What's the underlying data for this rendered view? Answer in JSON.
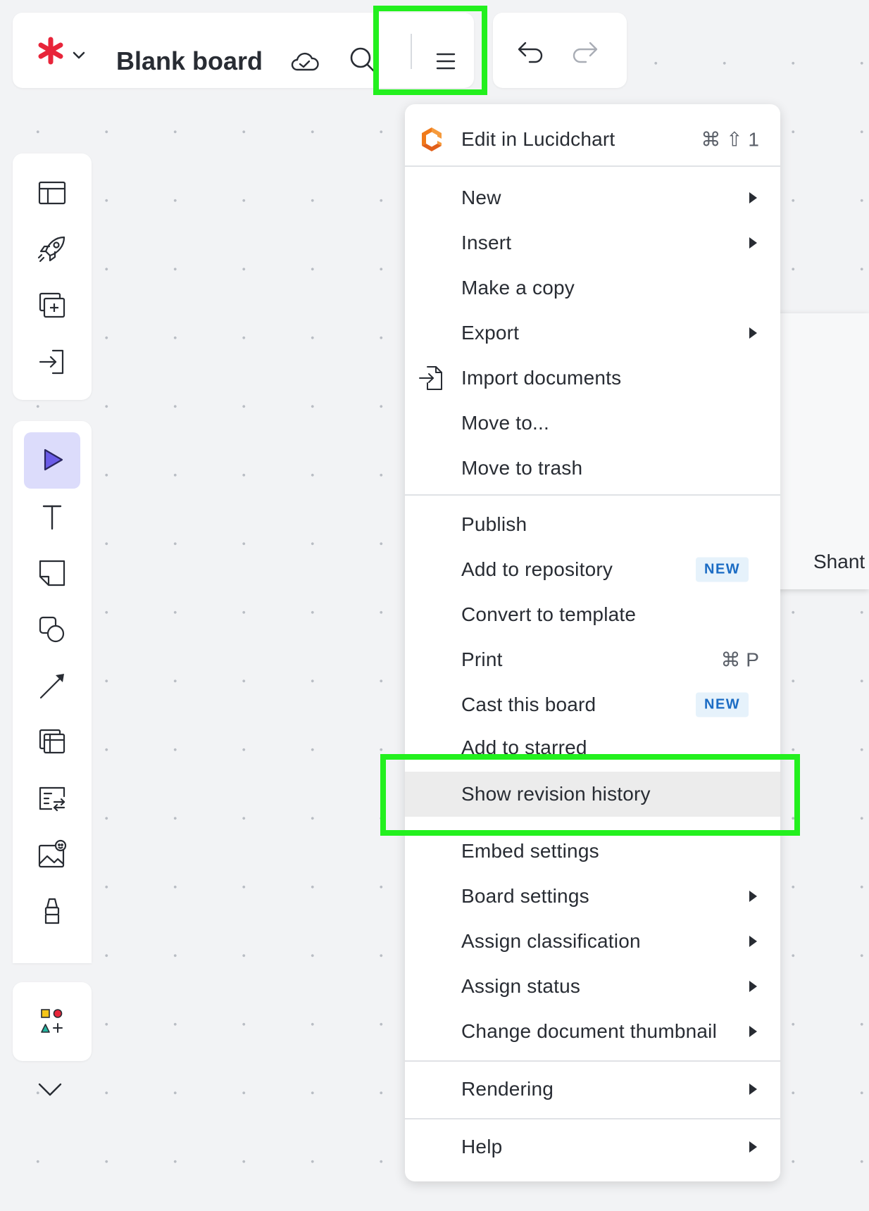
{
  "header": {
    "board_title": "Blank board"
  },
  "menu": {
    "edit_in": {
      "label": "Edit in Lucidchart",
      "shortcut": "⌘ ⇧ 1"
    },
    "groups": [
      [
        {
          "label": "New",
          "submenu": true
        },
        {
          "label": "Insert",
          "submenu": true
        },
        {
          "label": "Make a copy"
        },
        {
          "label": "Export",
          "submenu": true
        },
        {
          "label": "Import documents",
          "icon": "import-document-icon"
        },
        {
          "label": "Move to..."
        },
        {
          "label": "Move to trash"
        }
      ],
      [
        {
          "label": "Publish"
        },
        {
          "label": "Add to repository",
          "badge": "NEW"
        },
        {
          "label": "Convert to template"
        },
        {
          "label": "Print",
          "shortcut": "⌘ P"
        },
        {
          "label": "Cast this board",
          "badge": "NEW"
        },
        {
          "label": "Add to starred"
        },
        {
          "label": "Show revision history",
          "hovered": true
        },
        {
          "label": "Embed settings"
        },
        {
          "label": "Board settings",
          "submenu": true
        },
        {
          "label": "Assign classification",
          "submenu": true
        },
        {
          "label": "Assign status",
          "submenu": true
        },
        {
          "label": "Change document thumbnail",
          "submenu": true
        }
      ],
      [
        {
          "label": "Rendering",
          "submenu": true
        }
      ],
      [
        {
          "label": "Help",
          "submenu": true
        }
      ]
    ]
  },
  "side_panel": {
    "name_fragment": "Shant"
  },
  "colors": {
    "highlight": "#23f01e",
    "logo_red": "#e8253a",
    "active_tool_bg": "#dcdcfb",
    "active_tool_icon": "#6b5ce7",
    "badge_bg": "#e6f2fb",
    "badge_text": "#1b6cc4",
    "lucidchart_orange": "#f07a1a"
  },
  "left_toolbar": {
    "top": [
      "templates-icon",
      "rocket-icon",
      "add-frame-icon",
      "import-icon"
    ],
    "main": [
      "select-tool-icon",
      "text-tool-icon",
      "sticky-note-icon",
      "shapes-icon",
      "line-icon",
      "frame-icon",
      "table-icon",
      "image-icon",
      "marker-icon"
    ],
    "bottom": [
      "shape-library-icon"
    ]
  }
}
